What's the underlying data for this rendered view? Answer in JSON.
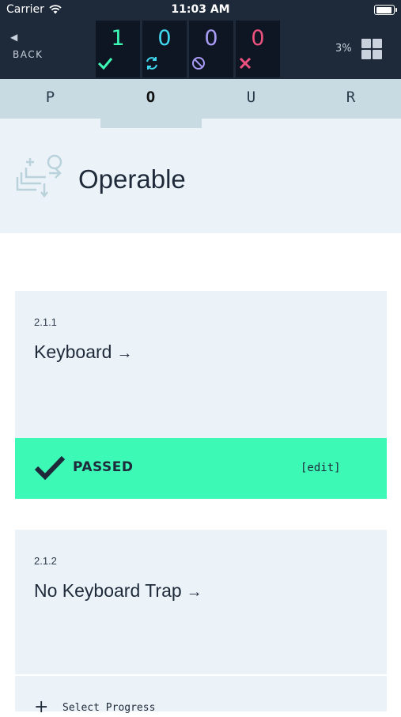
{
  "status_bar": {
    "carrier": "Carrier",
    "time": "11:03 AM"
  },
  "header": {
    "back_label": "BACK",
    "back_arrow": "◀",
    "percent": "3%",
    "counters": [
      {
        "value": "1",
        "icon": "check-icon",
        "color": "#3cf9b6"
      },
      {
        "value": "0",
        "icon": "refresh-icon",
        "color": "#40d9f0"
      },
      {
        "value": "0",
        "icon": "blocked-icon",
        "color": "#a99cf6"
      },
      {
        "value": "0",
        "icon": "x-icon",
        "color": "#f0527f"
      }
    ]
  },
  "tabs": [
    {
      "label": "P",
      "active": false
    },
    {
      "label": "O",
      "active": true
    },
    {
      "label": "U",
      "active": false
    },
    {
      "label": "R",
      "active": false
    }
  ],
  "hero": {
    "title": "Operable",
    "icon": "operable-icon"
  },
  "cards": [
    {
      "number": "2.1.1",
      "title": "Keyboard",
      "arrow": "→",
      "status": "PASSED",
      "edit_label": "[edit]"
    },
    {
      "number": "2.1.2",
      "title": "No Keyboard Trap",
      "arrow": "→"
    }
  ],
  "progress": {
    "plus": "+",
    "label": "Select Progress"
  },
  "colors": {
    "header_bg": "#1e2a3a",
    "counter_bg": "#0f1623",
    "tabs_bg": "#c8dbe3",
    "card_bg": "#ecf3f8",
    "passed": "#3cf9b6"
  }
}
